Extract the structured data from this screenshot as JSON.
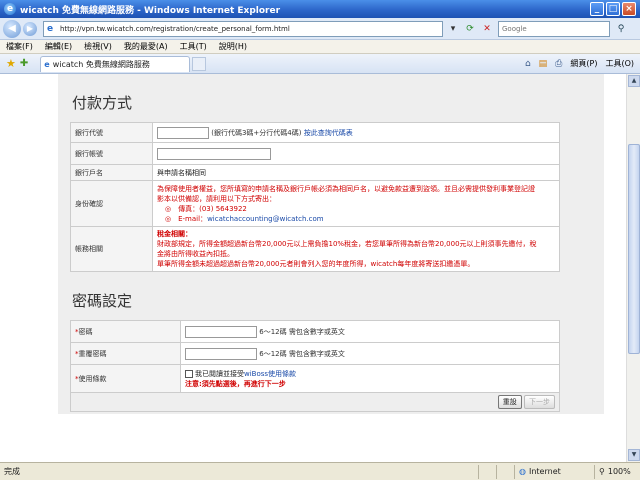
{
  "window": {
    "title": "wicatch 免費無線網路服務 - Windows Internet Explorer"
  },
  "address": {
    "url": "http://vpn.tw.wicatch.com/registration/create_personal_form.html",
    "search_placeholder": "Google"
  },
  "menu": [
    "檔案(F)",
    "編輯(E)",
    "檢視(V)",
    "我的最愛(A)",
    "工具(T)",
    "說明(H)"
  ],
  "tab": {
    "label": "wicatch 免費無線網路服務"
  },
  "commands": {
    "page": "網頁(P)",
    "tools": "工具(O)"
  },
  "payment": {
    "title": "付款方式",
    "bank_code_label": "銀行代號",
    "bank_code_hint": "(銀行代碼3碼+分行代碼4碼)",
    "bank_code_link": "按此查詢代碼表",
    "bank_account_label": "銀行帳號",
    "account_name_label": "銀行戶名",
    "account_name_value": "與申請名稱相同",
    "id_label": "身份確認",
    "id_line1": "為保障使用者權益，您所填寫的申請名稱及銀行戶帳必須為相同戶名，以避免款益遭到盜領。並且必需提供發利事業登記證",
    "id_line2": "影本以供備認，請利用以下方式寄出：",
    "id_fax": "◎　傳真：(03) 5643922",
    "id_email_prefix": "◎　E-mail：",
    "id_email": "wicatchaccounting@wicatch.com",
    "notes_label": "帳務相關",
    "tax_title": "稅金相關：",
    "tax_line1": "財政部規定，所得金額超過新台幣20,000元以上需負擔10%稅金，若您單筆所得為新台幣20,000元以上則須事先繳付，稅",
    "tax_line2": "金將由所得收益內扣抵。",
    "tax_line3": "單筆所得金額未超過超過新台幣20,000元者則會列入您的年度所得，wicatch每年度將寄送扣繳憑單。"
  },
  "password": {
    "title": "密碼設定",
    "required_mark": "*",
    "password_label": "密碼",
    "password_hint": "6～12碼 需包含數字或英文",
    "confirm_label": "重覆密碼",
    "confirm_hint": "6～12碼 需包含數字或英文",
    "terms_label": "使用條款",
    "terms_text": "我已閱讀並接受",
    "terms_link": "wiBoss使用條款",
    "terms_warning": "注意:須先點選後，再進行下一步",
    "reset_button": "重設",
    "next_button": "下一步"
  },
  "status": {
    "text": "完成",
    "zone": "Internet",
    "zoom": "100%"
  }
}
